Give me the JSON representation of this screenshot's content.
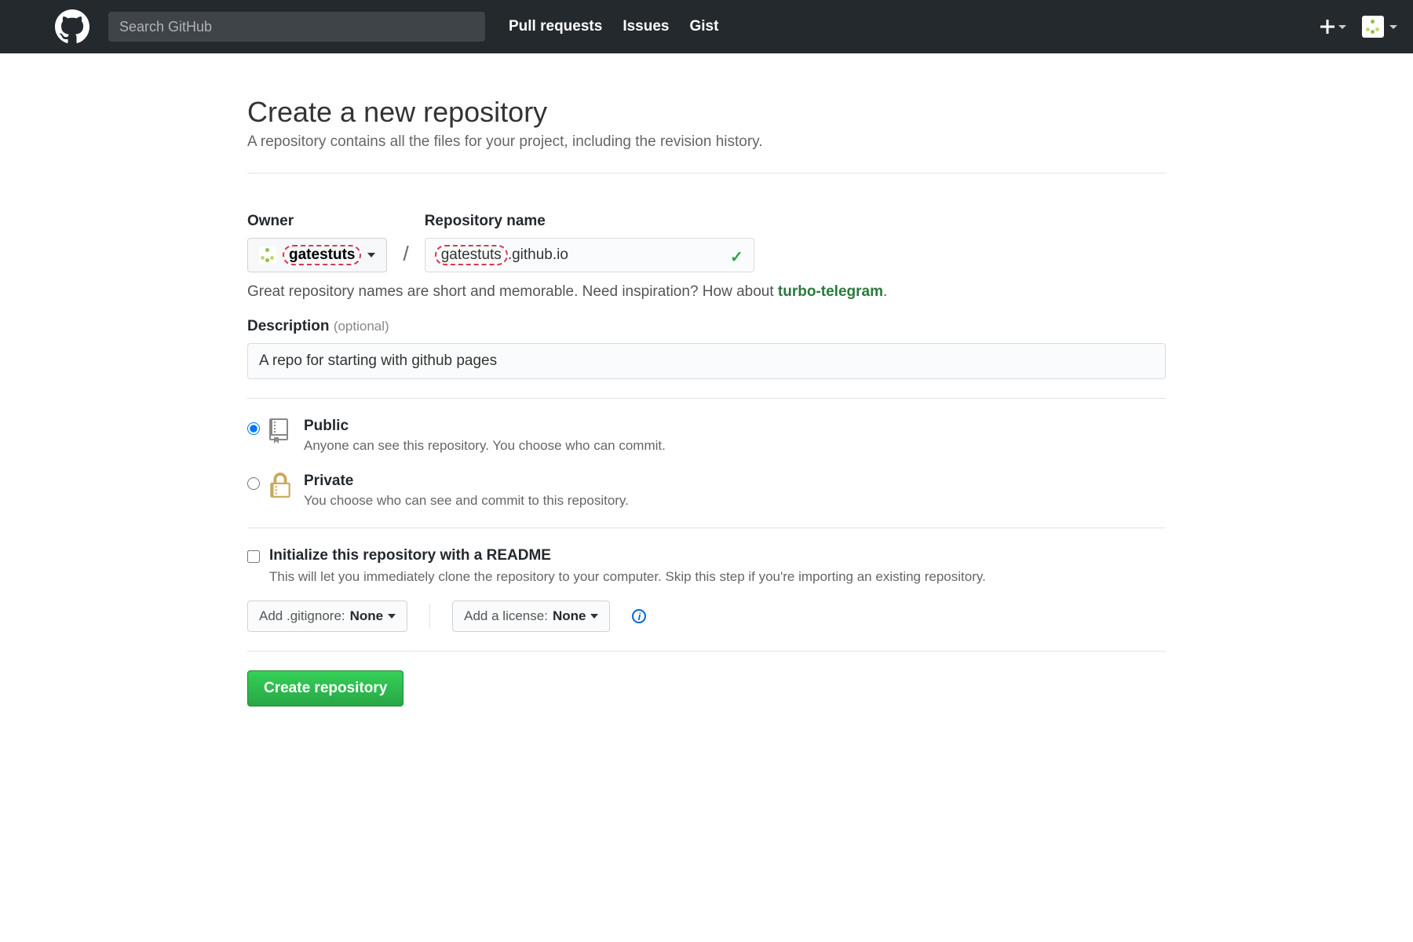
{
  "header": {
    "search_placeholder": "Search GitHub",
    "nav": {
      "pulls": "Pull requests",
      "issues": "Issues",
      "gist": "Gist"
    }
  },
  "page": {
    "title": "Create a new repository",
    "subtitle": "A repository contains all the files for your project, including the revision history."
  },
  "form": {
    "owner_label": "Owner",
    "owner_value": "gatestuts",
    "repo_label": "Repository name",
    "repo_value": "gatestuts.github.io",
    "repo_highlight_part": "gatestuts",
    "repo_rest_part": ".github.io",
    "slash": "/",
    "hint_prefix": "Great repository names are short and memorable. Need inspiration? How about ",
    "hint_suggestion": "turbo-telegram",
    "hint_suffix": ".",
    "desc_label": "Description",
    "desc_optional": "(optional)",
    "desc_value": "A repo for starting with github pages",
    "visibility": {
      "public": {
        "title": "Public",
        "desc": "Anyone can see this repository. You choose who can commit."
      },
      "private": {
        "title": "Private",
        "desc": "You choose who can see and commit to this repository."
      }
    },
    "readme": {
      "title": "Initialize this repository with a README",
      "desc": "This will let you immediately clone the repository to your computer. Skip this step if you're importing an existing repository."
    },
    "gitignore": {
      "label": "Add .gitignore: ",
      "value": "None"
    },
    "license": {
      "label": "Add a license: ",
      "value": "None"
    },
    "submit": "Create repository"
  }
}
